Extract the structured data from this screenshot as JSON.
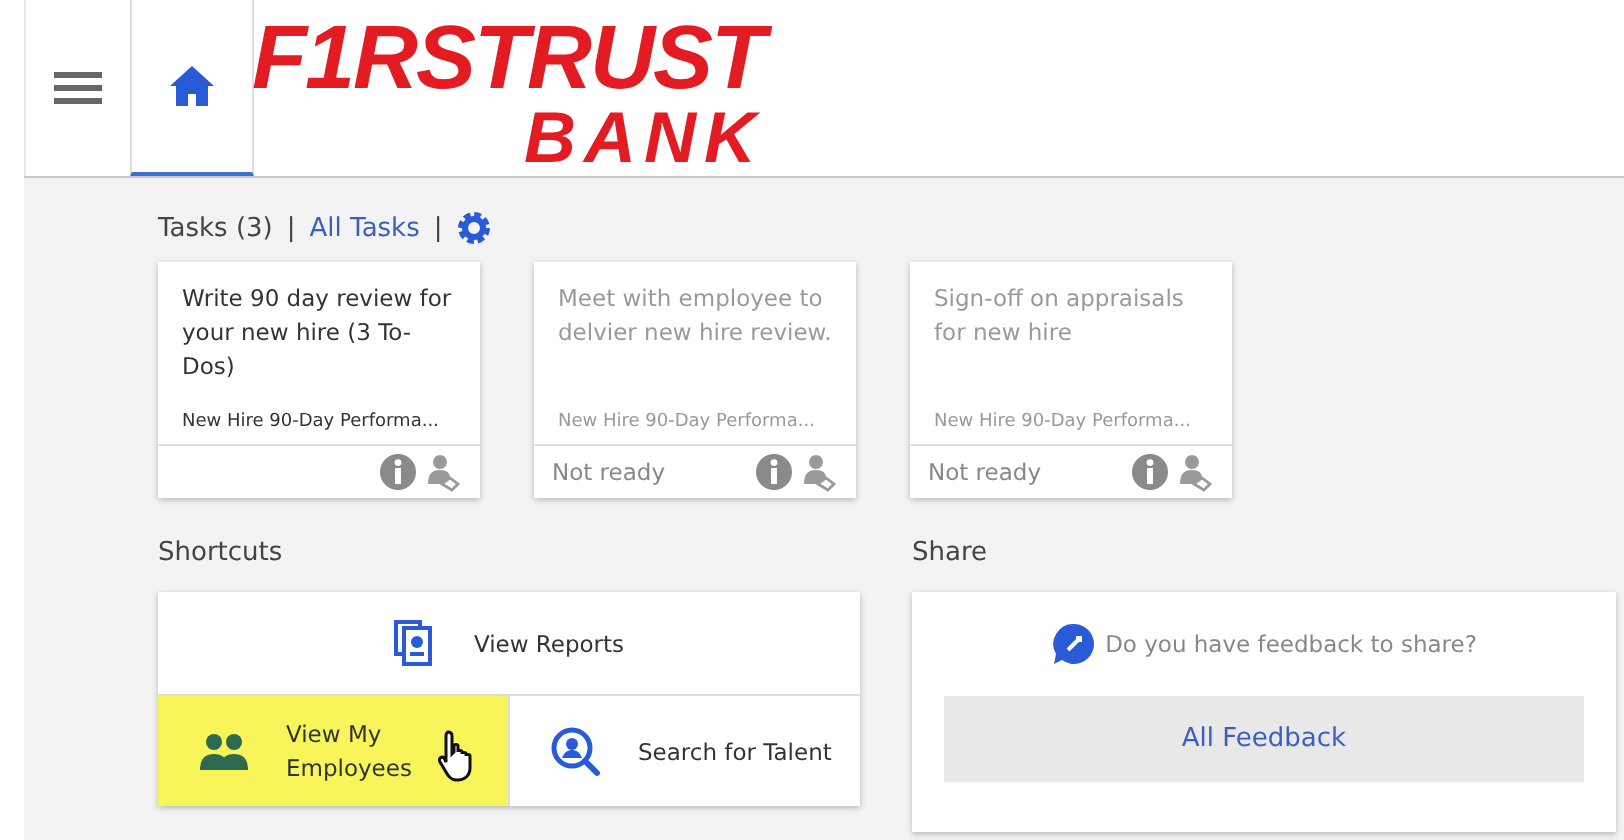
{
  "header": {
    "logo": {
      "line_1": "F1RSTRUST",
      "line_2": "BANK"
    },
    "home_tab": {
      "selected": true
    }
  },
  "tasks": {
    "title": "Tasks (3)",
    "separator_1": "|",
    "all_link": "All Tasks",
    "separator_2": "|",
    "items": [
      {
        "text": "Write 90 day review for your new hire (3 To-Dos)",
        "subtitle": "New Hire 90-Day Performa...",
        "disabled": false
      },
      {
        "text": "Meet with employee to delvier new hire review.",
        "subtitle": "New Hire 90-Day Performa...",
        "status": "Not ready",
        "disabled": true
      },
      {
        "text": "Sign-off on appraisals for new hire",
        "subtitle": "New Hire 90-Day Performa...",
        "status": "Not ready",
        "disabled": true
      }
    ]
  },
  "shortcuts": {
    "title": "Shortcuts",
    "items": [
      {
        "label": "View Reports",
        "kind": "reports",
        "highlighted": false
      },
      {
        "label": "View My Employees",
        "kind": "employees",
        "highlighted": true
      },
      {
        "label": "Search for Talent",
        "kind": "talent",
        "highlighted": false
      }
    ]
  },
  "share": {
    "title": "Share",
    "prompt": "Do you have feedback to share?",
    "button": "All Feedback"
  }
}
